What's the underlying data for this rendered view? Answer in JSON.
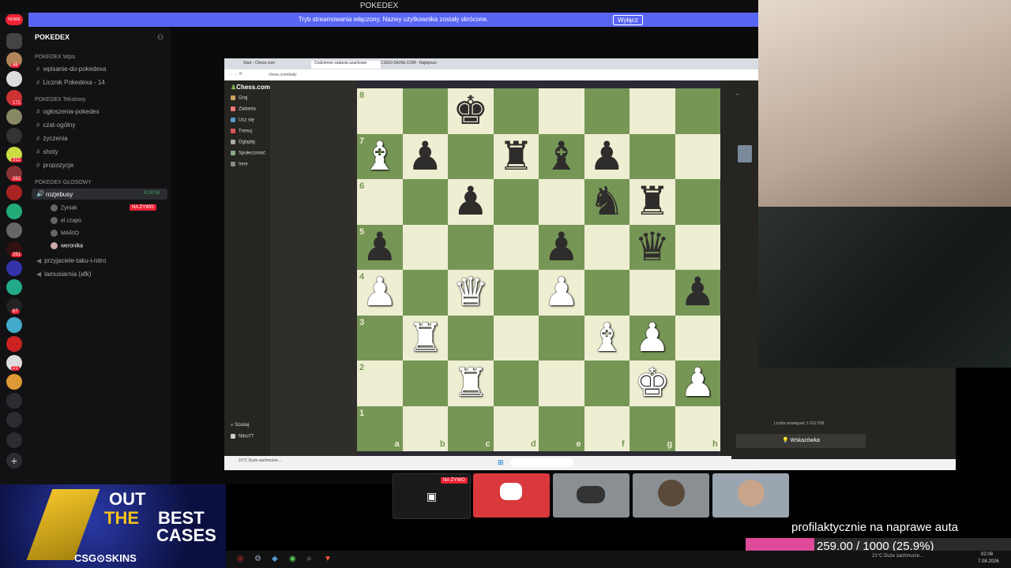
{
  "window": {
    "title": "POKEDEX"
  },
  "stream_banner": {
    "message": "Tryb streamowania włączony. Nazwy użytkownika zostały skrócone.",
    "button": "Wyłącz"
  },
  "server": {
    "name": "POKEDEX"
  },
  "sidebar": {
    "cat1": "POKEDEX Wpis",
    "cat1_channels": [
      "wpisanie-do-pokedexa",
      "Licznik Pokedexa - 14"
    ],
    "cat2": "POKEDEX Tekstowy",
    "cat2_channels": [
      "ogłoszenia-pokedex",
      "czat-ogólny",
      "życzenia",
      "shoty",
      "propozycje"
    ],
    "cat3": "POKEDEX GŁOSOWY",
    "voice_channel": "rozjebusy",
    "voice_time": "4:18:08",
    "voice_users": [
      "Zyniak",
      "el czapo",
      "MARIO",
      "weronika"
    ],
    "live_badge": "NA ŻYWO",
    "other_channels": [
      "przyjaciele-taku-i-nitro",
      "lamusiarnia (afk)"
    ],
    "server_badges": [
      "NOWE",
      "46",
      "172",
      "311",
      "262",
      "251",
      "67",
      "21"
    ]
  },
  "browser": {
    "tabs": [
      "Start - Chess.com",
      "Codzienne zadania szachowe",
      "CSGO-SKINS.COM - Najlepsze"
    ],
    "url": "chess.com/daily"
  },
  "chess_nav": {
    "logo": "Chess.com",
    "items": [
      "Graj",
      "Zadania",
      "Ucz się",
      "Trenuj",
      "Oglądaj",
      "Społeczność",
      "Inne"
    ],
    "search": "Szukaj",
    "user": "Nitro77"
  },
  "chess_board": {
    "files": [
      "a",
      "b",
      "c",
      "d",
      "e",
      "f",
      "g",
      "h"
    ],
    "ranks": [
      "8",
      "7",
      "6",
      "5",
      "4",
      "3",
      "2",
      "1"
    ],
    "pieces": [
      {
        "square": "c8",
        "glyph": "♚",
        "color": "b"
      },
      {
        "square": "a7",
        "glyph": "♝",
        "color": "w"
      },
      {
        "square": "b7",
        "glyph": "♟",
        "color": "b"
      },
      {
        "square": "d7",
        "glyph": "♜",
        "color": "b"
      },
      {
        "square": "e7",
        "glyph": "♝",
        "color": "b"
      },
      {
        "square": "f7",
        "glyph": "♟",
        "color": "b"
      },
      {
        "square": "c6",
        "glyph": "♟",
        "color": "b"
      },
      {
        "square": "f6",
        "glyph": "♞",
        "color": "b"
      },
      {
        "square": "g6",
        "glyph": "♜",
        "color": "b"
      },
      {
        "square": "a5",
        "glyph": "♟",
        "color": "b"
      },
      {
        "square": "e5",
        "glyph": "♟",
        "color": "b"
      },
      {
        "square": "g5",
        "glyph": "♛",
        "color": "b"
      },
      {
        "square": "a4",
        "glyph": "♟",
        "color": "w"
      },
      {
        "square": "c4",
        "glyph": "♛",
        "color": "w"
      },
      {
        "square": "e4",
        "glyph": "♟",
        "color": "w"
      },
      {
        "square": "h4",
        "glyph": "♟",
        "color": "b"
      },
      {
        "square": "b3",
        "glyph": "♜",
        "color": "w"
      },
      {
        "square": "f3",
        "glyph": "♝",
        "color": "w"
      },
      {
        "square": "g3",
        "glyph": "♟",
        "color": "w"
      },
      {
        "square": "c2",
        "glyph": "♜",
        "color": "w"
      },
      {
        "square": "g2",
        "glyph": "♚",
        "color": "w"
      },
      {
        "square": "h2",
        "glyph": "♟",
        "color": "w"
      }
    ]
  },
  "chess_panel": {
    "solved_count": "Liczba rozwiązań: 1 012 036",
    "hint_button": "Wskazówka"
  },
  "participants": {
    "live_badge": "NA ŻYWO"
  },
  "ad": {
    "line1": "OUT",
    "line2a": "THE",
    "line2b": "BEST",
    "line3": "CASES",
    "brand": "CSG⊙SKINS"
  },
  "goal": {
    "title": "profilaktycznie na naprawe auta",
    "progress_text": "259.00 / 1000 (25.9%)",
    "progress_fraction": 0.259,
    "color": "#e04a9a"
  },
  "clock": {
    "time": "02:08",
    "date": "7.08.2026",
    "weather": "21°C Duże zachmurze..."
  }
}
